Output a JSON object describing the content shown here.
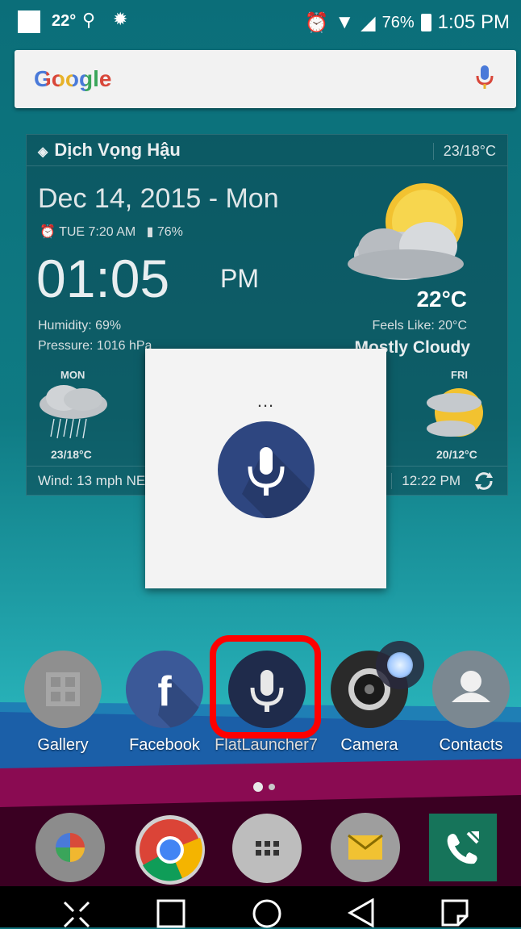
{
  "status_bar": {
    "temperature": "22°",
    "battery": "76%",
    "time": "1:05 PM"
  },
  "search": {
    "logo": "Google",
    "icons": {
      "mic": "mic-icon"
    }
  },
  "weather": {
    "location": "Dịch Vọng Hậu",
    "today_range": "23/18°C",
    "date": "Dec 14, 2015 - Mon",
    "alarm": "TUE 7:20 AM",
    "battery": "76%",
    "time": "01:05",
    "ampm": "PM",
    "humidity": "Humidity: 69%",
    "pressure": "Pressure: 1016 hPa",
    "temperature": "22°C",
    "feels_like": "Feels Like: 20°C",
    "condition": "Mostly Cloudy",
    "forecast": [
      {
        "day": "MON",
        "range": "23/18°C"
      },
      {
        "day": "FRI",
        "range": "20/12°C"
      }
    ],
    "wind": "Wind: 13 mph NE",
    "updated": "12:22 PM"
  },
  "voice_dialog": {
    "listening": "..."
  },
  "home_apps": [
    {
      "label": "Gallery"
    },
    {
      "label": "Facebook"
    },
    {
      "label": "FlatLauncher7"
    },
    {
      "label": "Camera"
    },
    {
      "label": "Contacts"
    }
  ],
  "dock_apps": [
    "photos-app",
    "chrome-app",
    "app-drawer",
    "email-app",
    "phone-app"
  ],
  "colors": {
    "mic_accent": "#2e4680",
    "highlight": "#ff0000",
    "wallpaper_teal": "#0d6f78",
    "wallpaper_blue": "#1b5fa8",
    "wallpaper_magenta": "#8a0b52"
  }
}
